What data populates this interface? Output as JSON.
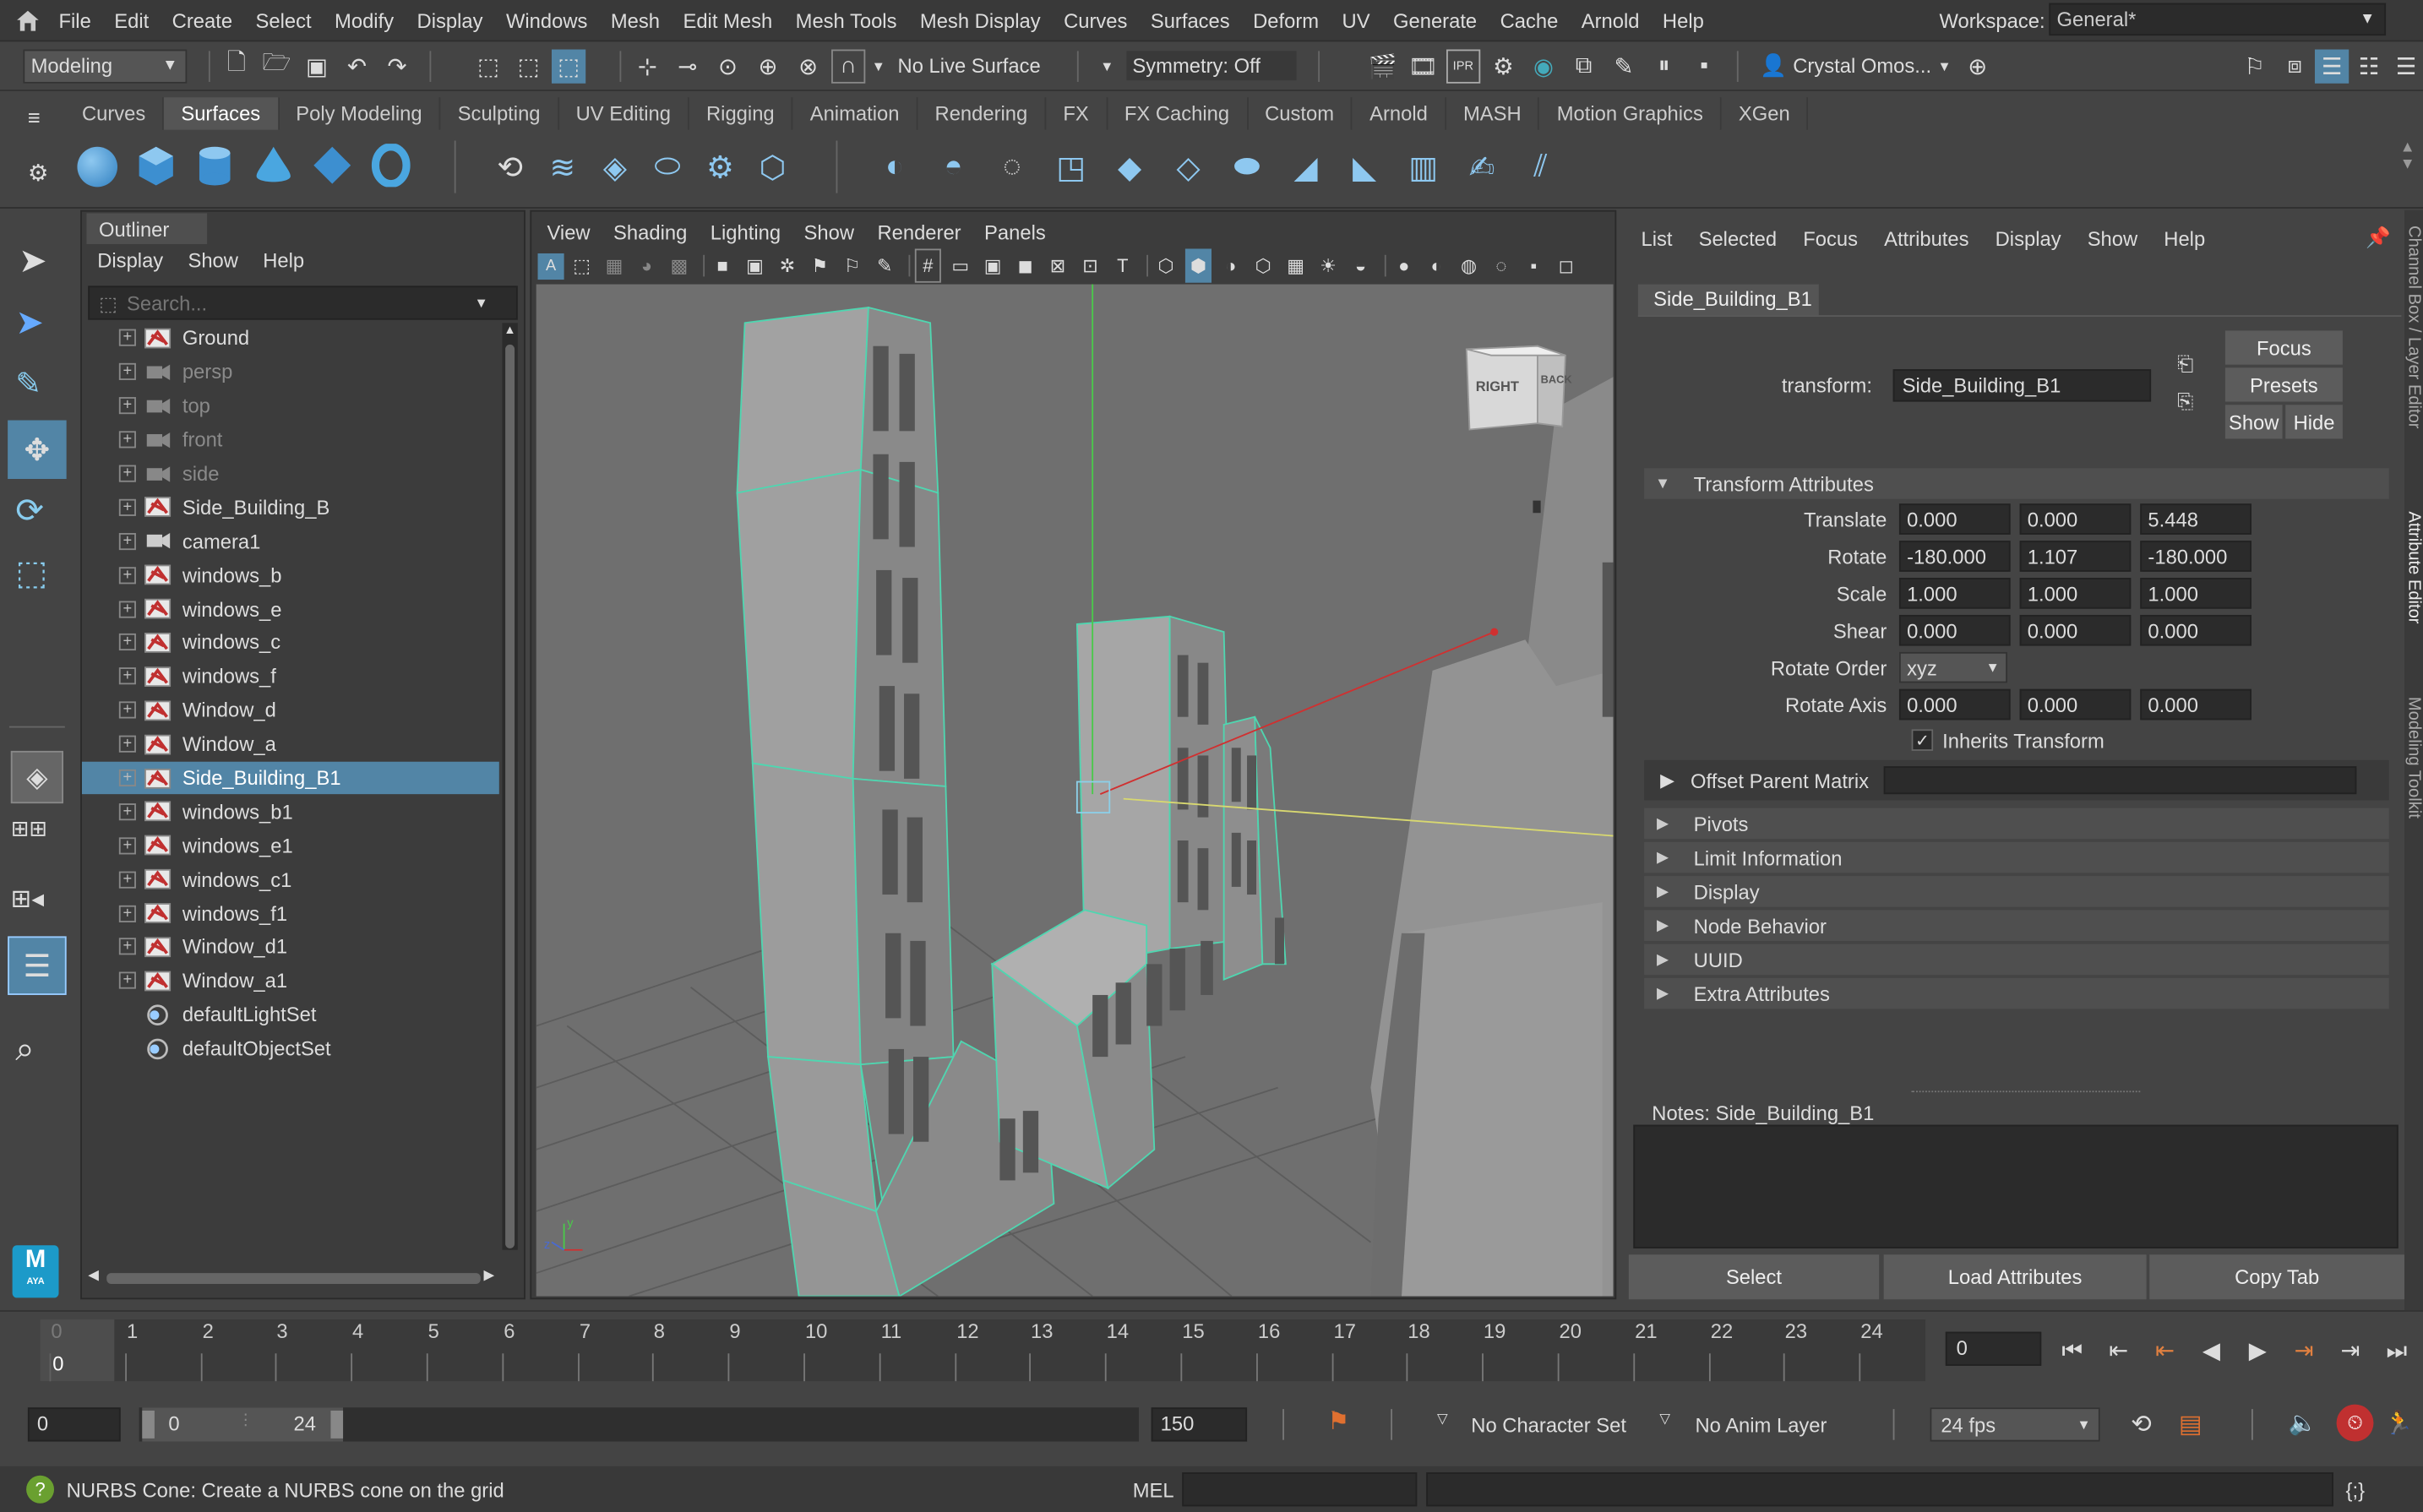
{
  "menus": [
    "File",
    "Edit",
    "Create",
    "Select",
    "Modify",
    "Display",
    "Windows",
    "Mesh",
    "Edit Mesh",
    "Mesh Tools",
    "Mesh Display",
    "Curves",
    "Surfaces",
    "Deform",
    "UV",
    "Generate",
    "Cache",
    "Arnold",
    "Help"
  ],
  "workspace": {
    "label": "Workspace:",
    "value": "General*"
  },
  "toolbar": {
    "mode": "Modeling",
    "live_surface": "No Live Surface",
    "symmetry": "Symmetry: Off",
    "user": "Crystal Omos..."
  },
  "shelf_tabs": [
    "Curves",
    "Surfaces",
    "Poly Modeling",
    "Sculpting",
    "UV Editing",
    "Rigging",
    "Animation",
    "Rendering",
    "FX",
    "FX Caching",
    "Custom",
    "Arnold",
    "MASH",
    "Motion Graphics",
    "XGen"
  ],
  "shelf_active": "Surfaces",
  "outliner": {
    "title": "Outliner",
    "menus": [
      "Display",
      "Show",
      "Help"
    ],
    "search_placeholder": "Search...",
    "items": [
      {
        "label": "Ground",
        "type": "mesh",
        "dim": false,
        "sel": false
      },
      {
        "label": "persp",
        "type": "camera",
        "dim": true,
        "sel": false
      },
      {
        "label": "top",
        "type": "camera",
        "dim": true,
        "sel": false
      },
      {
        "label": "front",
        "type": "camera",
        "dim": true,
        "sel": false
      },
      {
        "label": "side",
        "type": "camera",
        "dim": true,
        "sel": false
      },
      {
        "label": "Side_Building_B",
        "type": "mesh",
        "dim": false,
        "sel": false
      },
      {
        "label": "camera1",
        "type": "camera",
        "dim": false,
        "sel": false
      },
      {
        "label": "windows_b",
        "type": "mesh",
        "dim": false,
        "sel": false
      },
      {
        "label": "windows_e",
        "type": "mesh",
        "dim": false,
        "sel": false
      },
      {
        "label": "windows_c",
        "type": "mesh",
        "dim": false,
        "sel": false
      },
      {
        "label": "windows_f",
        "type": "mesh",
        "dim": false,
        "sel": false
      },
      {
        "label": "Window_d",
        "type": "mesh",
        "dim": false,
        "sel": false
      },
      {
        "label": "Window_a",
        "type": "mesh",
        "dim": false,
        "sel": false
      },
      {
        "label": "Side_Building_B1",
        "type": "mesh",
        "dim": false,
        "sel": true
      },
      {
        "label": "windows_b1",
        "type": "mesh",
        "dim": false,
        "sel": false
      },
      {
        "label": "windows_e1",
        "type": "mesh",
        "dim": false,
        "sel": false
      },
      {
        "label": "windows_c1",
        "type": "mesh",
        "dim": false,
        "sel": false
      },
      {
        "label": "windows_f1",
        "type": "mesh",
        "dim": false,
        "sel": false
      },
      {
        "label": "Window_d1",
        "type": "mesh",
        "dim": false,
        "sel": false
      },
      {
        "label": "Window_a1",
        "type": "mesh",
        "dim": false,
        "sel": false
      },
      {
        "label": "defaultLightSet",
        "type": "set",
        "dim": false,
        "sel": false
      },
      {
        "label": "defaultObjectSet",
        "type": "set",
        "dim": false,
        "sel": false
      }
    ]
  },
  "viewport": {
    "menus": [
      "View",
      "Shading",
      "Lighting",
      "Show",
      "Renderer",
      "Panels"
    ],
    "cube_right": "RIGHT",
    "cube_back": "BACK"
  },
  "attr": {
    "menus": [
      "List",
      "Selected",
      "Focus",
      "Attributes",
      "Display",
      "Show",
      "Help"
    ],
    "tab": "Side_Building_B1",
    "transform_label": "transform:",
    "transform_value": "Side_Building_B1",
    "buttons": {
      "focus": "Focus",
      "presets": "Presets",
      "show": "Show",
      "hide": "Hide"
    },
    "section_transform": "Transform Attributes",
    "translate": {
      "label": "Translate",
      "x": "0.000",
      "y": "0.000",
      "z": "5.448"
    },
    "rotate": {
      "label": "Rotate",
      "x": "-180.000",
      "y": "1.107",
      "z": "-180.000"
    },
    "scale": {
      "label": "Scale",
      "x": "1.000",
      "y": "1.000",
      "z": "1.000"
    },
    "shear": {
      "label": "Shear",
      "x": "0.000",
      "y": "0.000",
      "z": "0.000"
    },
    "rotate_order": {
      "label": "Rotate Order",
      "value": "xyz"
    },
    "rotate_axis": {
      "label": "Rotate Axis",
      "x": "0.000",
      "y": "0.000",
      "z": "0.000"
    },
    "inherits": "Inherits Transform",
    "offset_parent": "Offset Parent Matrix",
    "sections": [
      "Pivots",
      "Limit Information",
      "Display",
      "Node Behavior",
      "UUID",
      "Extra Attributes"
    ],
    "notes_label": "Notes:  Side_Building_B1",
    "bottom": {
      "select": "Select",
      "load": "Load Attributes",
      "copy": "Copy Tab"
    },
    "side_tabs": {
      "channel": "Channel Box / Layer Editor",
      "attr": "Attribute Editor",
      "modeling": "Modeling Toolkit"
    }
  },
  "timeline": {
    "frames": [
      "0",
      "1",
      "2",
      "3",
      "4",
      "5",
      "6",
      "7",
      "8",
      "9",
      "10",
      "11",
      "12",
      "13",
      "14",
      "15",
      "16",
      "17",
      "18",
      "19",
      "20",
      "21",
      "22",
      "23",
      "24"
    ],
    "current": "0",
    "current_field": "0"
  },
  "range": {
    "start": "0",
    "inner_start": "0",
    "inner_end": "24",
    "end": "150",
    "char_set": "No Character Set",
    "anim_layer": "No Anim Layer",
    "fps": "24 fps"
  },
  "status": {
    "message": "NURBS Cone: Create a NURBS cone on the grid",
    "mel": "MEL"
  },
  "colors": {
    "accent": "#5285a6",
    "wire": "#4fd6b0",
    "bg": "#444444",
    "viewport_bg": "#6f6f6f"
  }
}
